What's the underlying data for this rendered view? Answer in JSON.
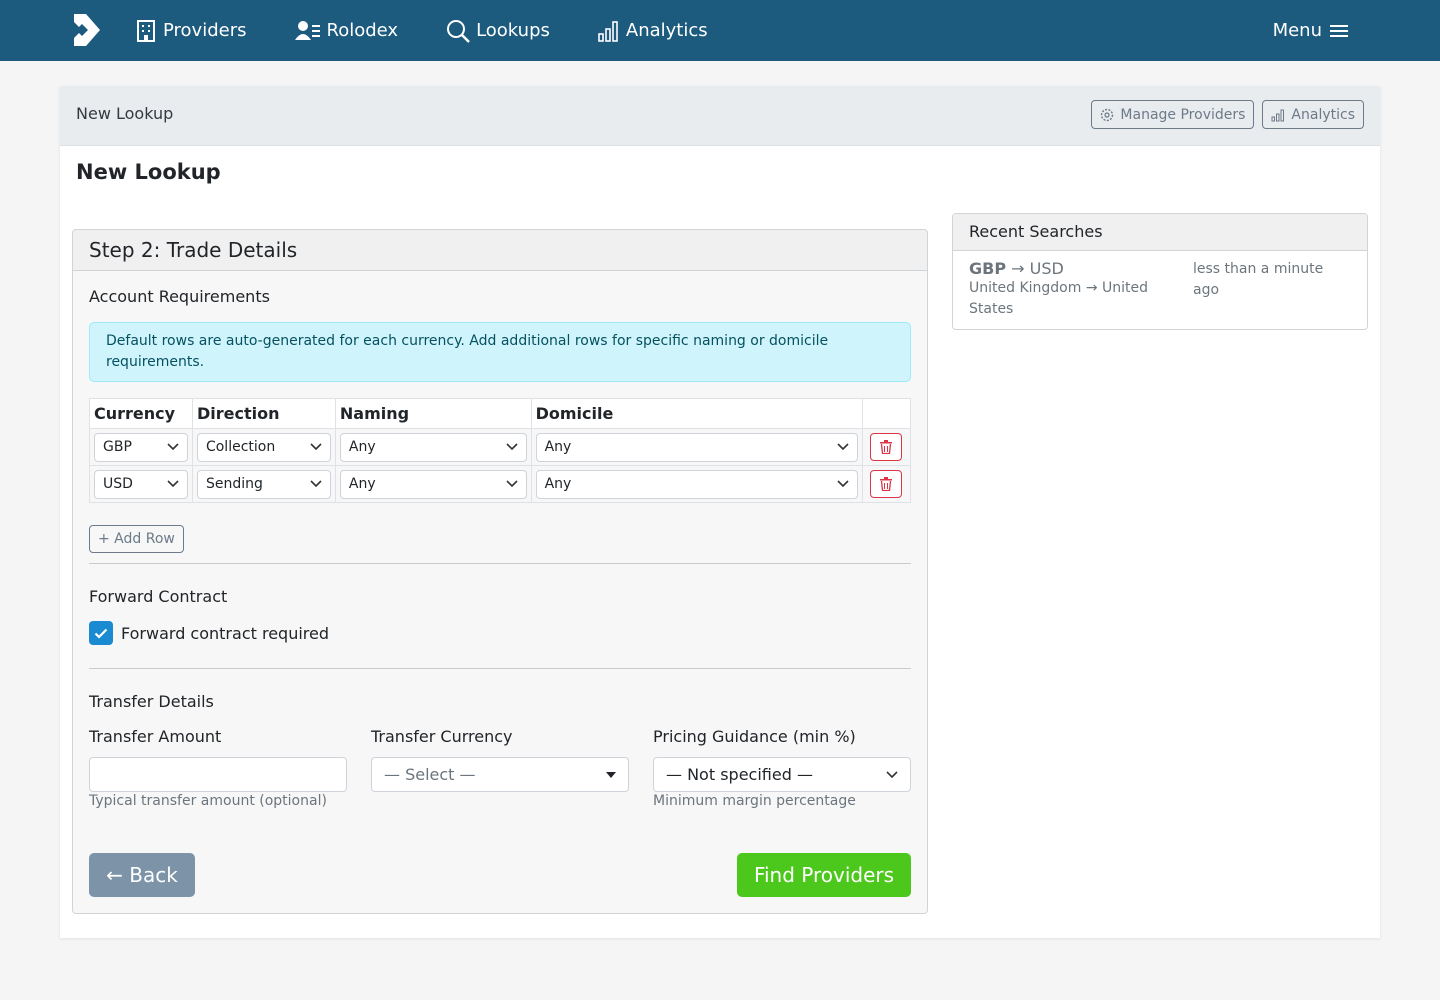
{
  "nav": {
    "items": [
      {
        "label": "Providers",
        "icon": "building-icon"
      },
      {
        "label": "Rolodex",
        "icon": "contacts-icon"
      },
      {
        "label": "Lookups",
        "icon": "search-icon"
      },
      {
        "label": "Analytics",
        "icon": "bar-chart-icon"
      }
    ],
    "menu_label": "Menu"
  },
  "header": {
    "breadcrumb": "New Lookup",
    "manage_providers_label": "Manage Providers",
    "analytics_label": "Analytics"
  },
  "page_title": "New Lookup",
  "step": {
    "title": "Step 2: Trade Details",
    "account_requirements": {
      "heading": "Account Requirements",
      "alert": "Default rows are auto-generated for each currency. Add additional rows for specific naming or domicile requirements.",
      "columns": [
        "Currency",
        "Direction",
        "Naming",
        "Domicile"
      ],
      "rows": [
        {
          "currency": "GBP",
          "direction": "Collection",
          "naming": "Any",
          "domicile": "Any"
        },
        {
          "currency": "USD",
          "direction": "Sending",
          "naming": "Any",
          "domicile": "Any"
        }
      ],
      "add_row_label": "+ Add Row"
    },
    "forward_contract": {
      "heading": "Forward Contract",
      "checkbox_label": "Forward contract required",
      "checked": true
    },
    "transfer_details": {
      "heading": "Transfer Details",
      "amount_label": "Transfer Amount",
      "amount_value": "",
      "amount_hint": "Typical transfer amount (optional)",
      "currency_label": "Transfer Currency",
      "currency_value": "— Select —",
      "pricing_label": "Pricing Guidance (min %)",
      "pricing_value": "— Not specified —",
      "pricing_hint": "Minimum margin percentage"
    },
    "back_label": "← Back",
    "find_label": "Find Providers"
  },
  "recent": {
    "title": "Recent Searches",
    "items": [
      {
        "from": "GBP",
        "arrow": "→",
        "to": "USD",
        "route": "United Kingdom → United States",
        "time": "less than a minute ago"
      }
    ]
  },
  "colors": {
    "nav_bg": "#1c5a7e",
    "find_button": "#4cc71b",
    "back_button": "#7c93a8",
    "checkbox": "#1a8bd0",
    "danger": "#dc3545"
  }
}
